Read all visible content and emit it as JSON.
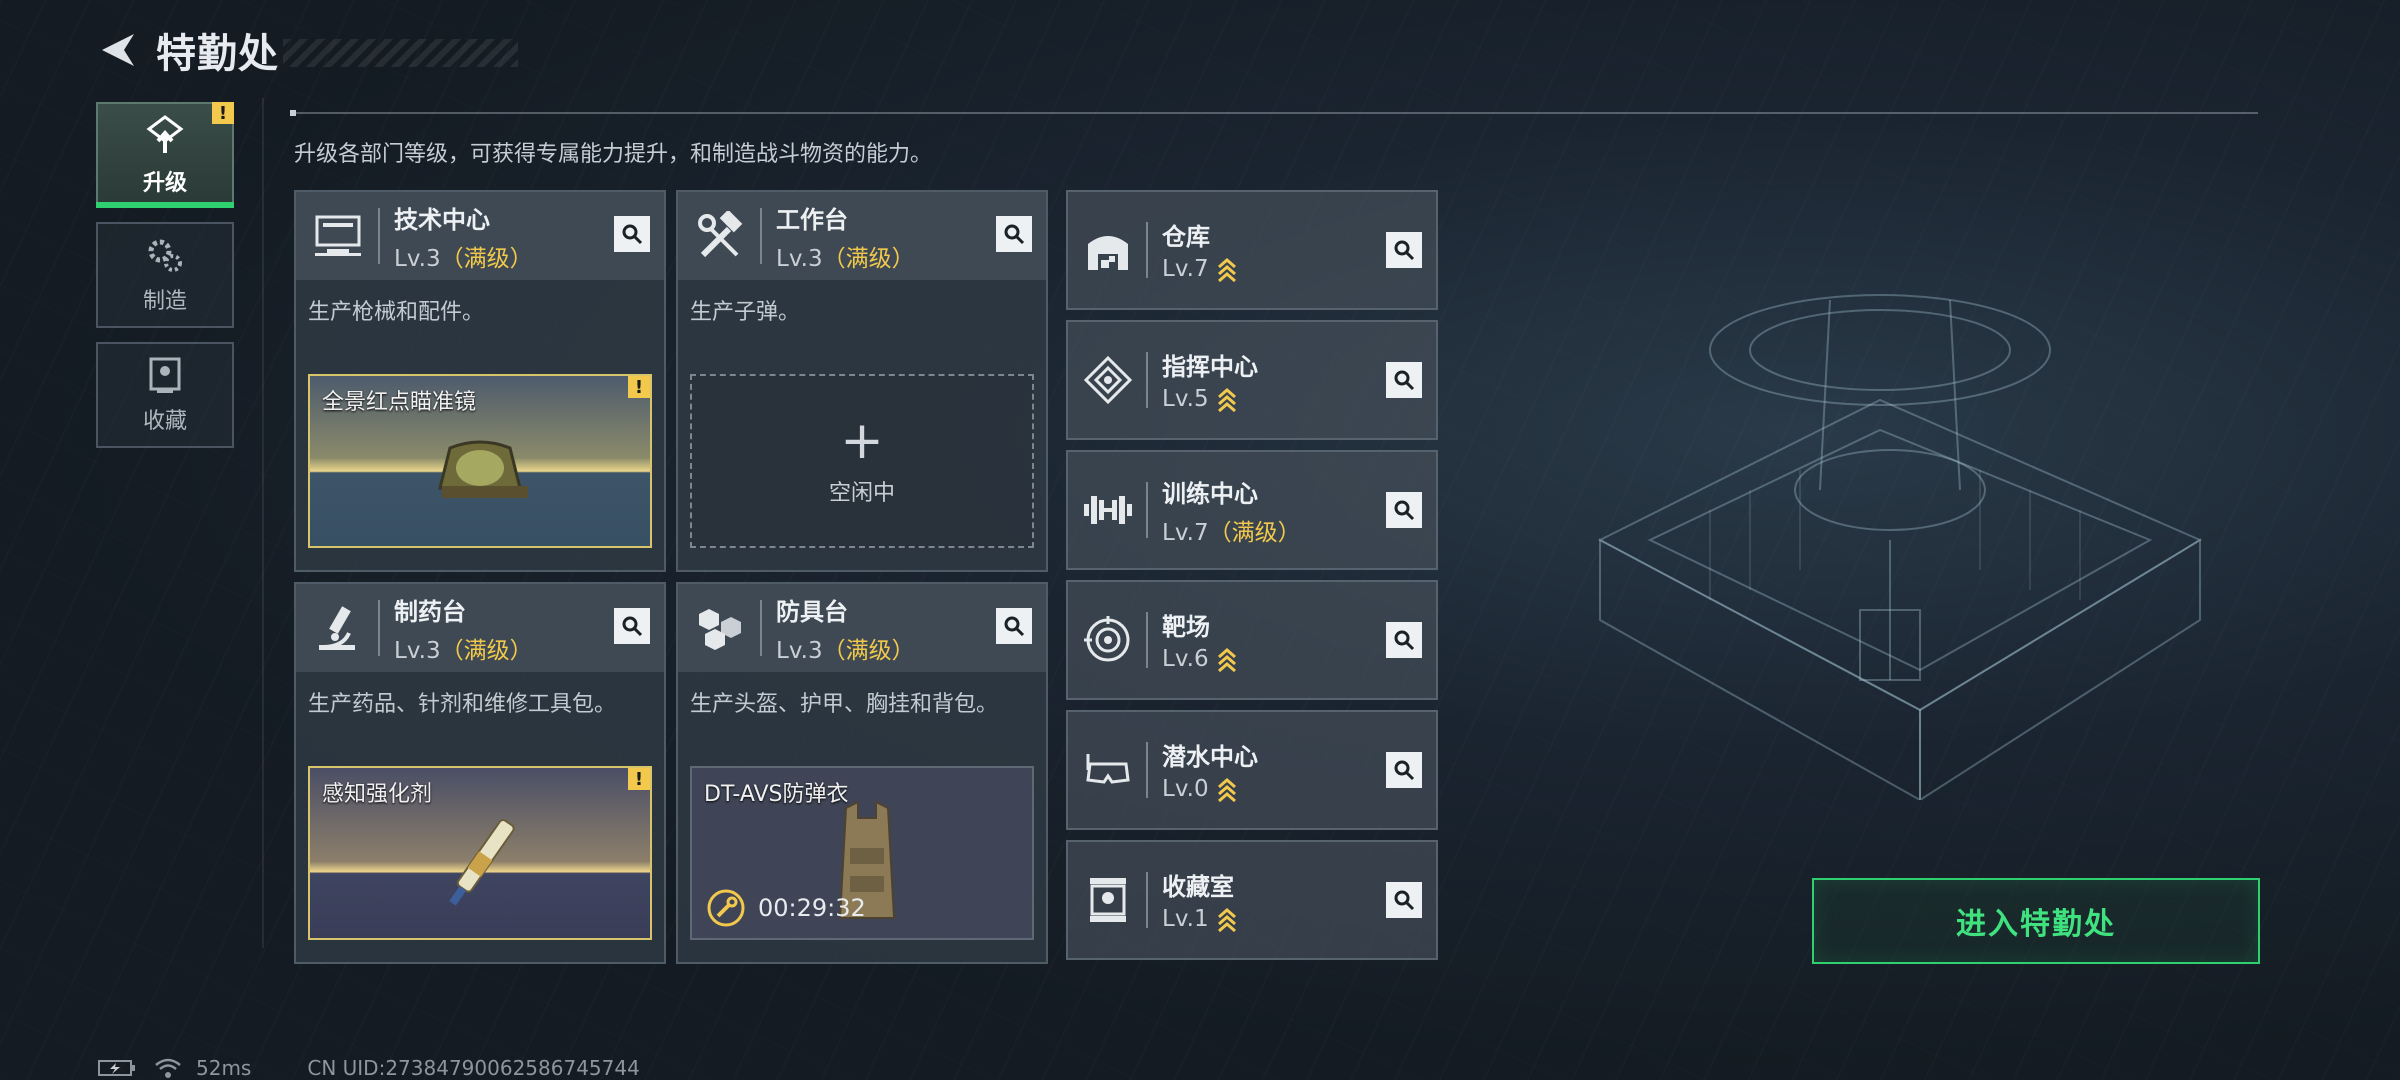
{
  "header": {
    "title": "特勤处"
  },
  "side_nav": [
    {
      "label": "升级",
      "icon": "upgrade-icon",
      "active": true,
      "badge": "!"
    },
    {
      "label": "制造",
      "icon": "gears-icon",
      "active": false
    },
    {
      "label": "收藏",
      "icon": "collection-icon",
      "active": false
    }
  ],
  "description": "升级各部门等级，可获得专属能力提升，和制造战斗物资的能力。",
  "departments": [
    {
      "name": "技术中心",
      "level": "Lv.3",
      "max": "（满级）",
      "desc": "生产枪械和配件。",
      "icon": "computer-icon",
      "slot": {
        "state": "item",
        "name": "全景红点瞄准镜",
        "badge": "!"
      }
    },
    {
      "name": "工作台",
      "level": "Lv.3",
      "max": "（满级）",
      "desc": "生产子弹。",
      "icon": "tools-icon",
      "slot": {
        "state": "idle",
        "label": "空闲中"
      }
    },
    {
      "name": "制药台",
      "level": "Lv.3",
      "max": "（满级）",
      "desc": "生产药品、针剂和维修工具包。",
      "icon": "microscope-icon",
      "slot": {
        "state": "item",
        "name": "感知强化剂",
        "badge": "!"
      }
    },
    {
      "name": "防具台",
      "level": "Lv.3",
      "max": "（满级）",
      "desc": "生产头盔、护甲、胸挂和背包。",
      "icon": "armor-blocks-icon",
      "slot": {
        "state": "busy",
        "name": "DT-AVS防弹衣",
        "timer": "00:29:32"
      }
    }
  ],
  "buildings": [
    {
      "name": "仓库",
      "level": "Lv.7",
      "max": "",
      "upgradable": true,
      "icon": "warehouse-icon"
    },
    {
      "name": "指挥中心",
      "level": "Lv.5",
      "max": "",
      "upgradable": true,
      "icon": "command-icon"
    },
    {
      "name": "训练中心",
      "level": "Lv.7",
      "max": "（满级）",
      "upgradable": false,
      "icon": "dumbbell-icon"
    },
    {
      "name": "靶场",
      "level": "Lv.6",
      "max": "",
      "upgradable": true,
      "icon": "target-icon"
    },
    {
      "name": "潜水中心",
      "level": "Lv.0",
      "max": "",
      "upgradable": true,
      "icon": "diving-mask-icon"
    },
    {
      "name": "收藏室",
      "level": "Lv.1",
      "max": "",
      "upgradable": true,
      "icon": "display-case-icon"
    }
  ],
  "enter_button": "进入特勤处",
  "status_bar": {
    "ping": "52ms",
    "uid": "CN UID:27384790062586745744"
  },
  "colors": {
    "accent_green": "#2fd06f",
    "gold": "#f2c94c"
  }
}
